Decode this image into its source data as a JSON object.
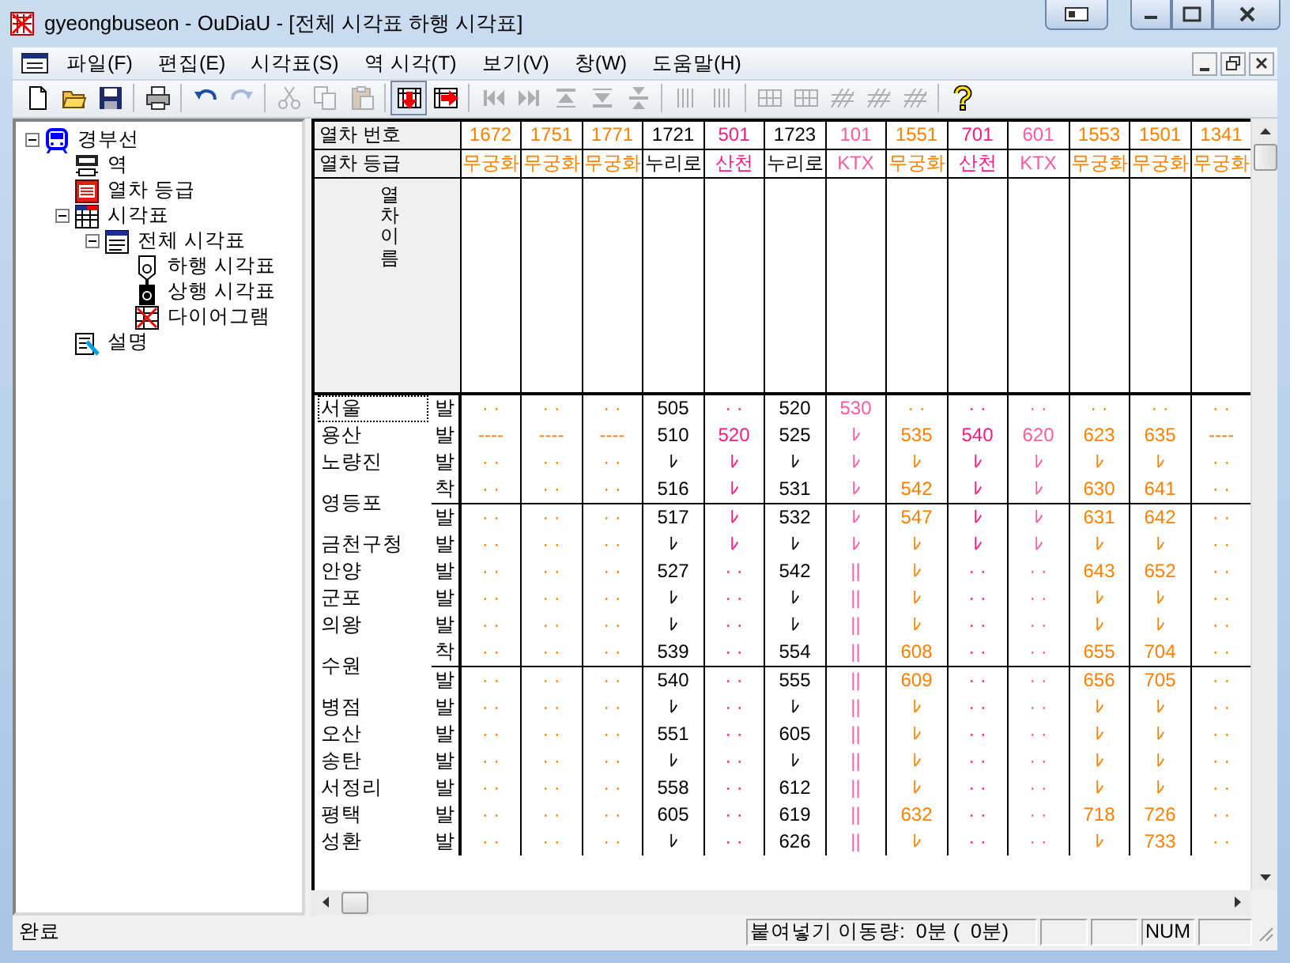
{
  "window": {
    "title": "gyeongbuseon - OuDiaU - [전체 시각표 하행 시각표]"
  },
  "menu": [
    "파일(F)",
    "편집(E)",
    "시각표(S)",
    "역 시각(T)",
    "보기(V)",
    "창(W)",
    "도움말(H)"
  ],
  "toolbar": [
    {
      "kind": "new",
      "disabled": false,
      "pressed": false
    },
    {
      "kind": "open",
      "disabled": false,
      "pressed": false
    },
    {
      "kind": "save",
      "disabled": false,
      "pressed": false
    },
    {
      "kind": "sep"
    },
    {
      "kind": "print",
      "disabled": false,
      "pressed": false
    },
    {
      "kind": "sep"
    },
    {
      "kind": "undo",
      "disabled": false,
      "pressed": false
    },
    {
      "kind": "redo",
      "disabled": true,
      "pressed": false
    },
    {
      "kind": "sep"
    },
    {
      "kind": "cut",
      "disabled": true,
      "pressed": false
    },
    {
      "kind": "copy",
      "disabled": true,
      "pressed": false
    },
    {
      "kind": "paste",
      "disabled": true,
      "pressed": false
    },
    {
      "kind": "sep"
    },
    {
      "kind": "down",
      "disabled": false,
      "pressed": true
    },
    {
      "kind": "right",
      "disabled": false,
      "pressed": false
    },
    {
      "kind": "sep"
    },
    {
      "kind": "first",
      "disabled": true,
      "pressed": false
    },
    {
      "kind": "last",
      "disabled": true,
      "pressed": false
    },
    {
      "kind": "top",
      "disabled": true,
      "pressed": false
    },
    {
      "kind": "bottom",
      "disabled": true,
      "pressed": false
    },
    {
      "kind": "middle",
      "disabled": true,
      "pressed": false
    },
    {
      "kind": "sep"
    },
    {
      "kind": "bars",
      "disabled": true,
      "pressed": false
    },
    {
      "kind": "bars",
      "disabled": true,
      "pressed": false
    },
    {
      "kind": "sep"
    },
    {
      "kind": "block",
      "disabled": true,
      "pressed": false
    },
    {
      "kind": "block",
      "disabled": true,
      "pressed": false
    },
    {
      "kind": "diagonal",
      "disabled": true,
      "pressed": false
    },
    {
      "kind": "diagonal",
      "disabled": true,
      "pressed": false
    },
    {
      "kind": "diagonal",
      "disabled": true,
      "pressed": false
    },
    {
      "kind": "sep"
    },
    {
      "kind": "help",
      "disabled": false,
      "pressed": false
    }
  ],
  "tree": [
    {
      "label": "경부선",
      "kind": "route",
      "expanded": true,
      "children": [
        {
          "label": "역",
          "kind": "station"
        },
        {
          "label": "열차 등급",
          "kind": "grade"
        },
        {
          "label": "시각표",
          "kind": "timetables",
          "expanded": true,
          "children": [
            {
              "label": "전체 시각표",
              "kind": "timetable",
              "expanded": true,
              "children": [
                {
                  "label": "하행 시각표",
                  "kind": "down"
                },
                {
                  "label": "상행 시각표",
                  "kind": "up"
                },
                {
                  "label": "다이어그램",
                  "kind": "diagram"
                }
              ]
            }
          ]
        },
        {
          "label": "설명",
          "kind": "note"
        }
      ]
    }
  ],
  "grid": {
    "number_label": "열차 번호",
    "grade_label": "열차 등급",
    "name_label": "열차 이름",
    "trains": [
      {
        "number": "1672",
        "grade": "무궁화",
        "color": "#ff8000"
      },
      {
        "number": "1751",
        "grade": "무궁화",
        "color": "#ff8000"
      },
      {
        "number": "1771",
        "grade": "무궁화",
        "color": "#ff8000"
      },
      {
        "number": "1721",
        "grade": "누리로",
        "color": "#000000"
      },
      {
        "number": "501",
        "grade": "산천",
        "color": "#ff1a80"
      },
      {
        "number": "1723",
        "grade": "누리로",
        "color": "#000000"
      },
      {
        "number": "101",
        "grade": "KTX",
        "color": "#ff5aa0"
      },
      {
        "number": "1551",
        "grade": "무궁화",
        "color": "#ff8000"
      },
      {
        "number": "701",
        "grade": "산천",
        "color": "#ff1a80"
      },
      {
        "number": "601",
        "grade": "KTX",
        "color": "#ff5aa0"
      },
      {
        "number": "1553",
        "grade": "무궁화",
        "color": "#ff8000"
      },
      {
        "number": "1501",
        "grade": "무궁화",
        "color": "#ff8000"
      },
      {
        "number": "1341",
        "grade": "무궁화",
        "color": "#ff8000"
      }
    ],
    "stations": [
      {
        "name": "서울",
        "selected": true,
        "stops": [
          {
            "kind": "발",
            "times": [
              "· ·",
              "· ·",
              "· ·",
              "505",
              "· ·",
              "520",
              "530",
              "· ·",
              "· ·",
              "· ·",
              "· ·",
              "· ·",
              "· ·"
            ]
          }
        ]
      },
      {
        "name": "용산",
        "selected": false,
        "stops": [
          {
            "kind": "발",
            "times": [
              "----",
              "----",
              "----",
              "510",
              "520",
              "525",
              "ﾚ",
              "535",
              "540",
              "620",
              "623",
              "635",
              "----"
            ]
          }
        ]
      },
      {
        "name": "노량진",
        "selected": false,
        "stops": [
          {
            "kind": "발",
            "times": [
              "· ·",
              "· ·",
              "· ·",
              "ﾚ",
              "ﾚ",
              "ﾚ",
              "ﾚ",
              "ﾚ",
              "ﾚ",
              "ﾚ",
              "ﾚ",
              "ﾚ",
              "· ·"
            ]
          }
        ]
      },
      {
        "name": "영등포",
        "selected": false,
        "stops": [
          {
            "kind": "착",
            "times": [
              "· ·",
              "· ·",
              "· ·",
              "516",
              "ﾚ",
              "531",
              "ﾚ",
              "542",
              "ﾚ",
              "ﾚ",
              "630",
              "641",
              "· ·"
            ]
          },
          {
            "kind": "발",
            "times": [
              "· ·",
              "· ·",
              "· ·",
              "517",
              "ﾚ",
              "532",
              "ﾚ",
              "547",
              "ﾚ",
              "ﾚ",
              "631",
              "642",
              "· ·"
            ]
          }
        ]
      },
      {
        "name": "금천구청",
        "selected": false,
        "stops": [
          {
            "kind": "발",
            "times": [
              "· ·",
              "· ·",
              "· ·",
              "ﾚ",
              "ﾚ",
              "ﾚ",
              "ﾚ",
              "ﾚ",
              "ﾚ",
              "ﾚ",
              "ﾚ",
              "ﾚ",
              "· ·"
            ]
          }
        ]
      },
      {
        "name": "안양",
        "selected": false,
        "stops": [
          {
            "kind": "발",
            "times": [
              "· ·",
              "· ·",
              "· ·",
              "527",
              "· ·",
              "542",
              "||",
              "ﾚ",
              "· ·",
              "· ·",
              "643",
              "652",
              "· ·"
            ]
          }
        ]
      },
      {
        "name": "군포",
        "selected": false,
        "stops": [
          {
            "kind": "발",
            "times": [
              "· ·",
              "· ·",
              "· ·",
              "ﾚ",
              "· ·",
              "ﾚ",
              "||",
              "ﾚ",
              "· ·",
              "· ·",
              "ﾚ",
              "ﾚ",
              "· ·"
            ]
          }
        ]
      },
      {
        "name": "의왕",
        "selected": false,
        "stops": [
          {
            "kind": "발",
            "times": [
              "· ·",
              "· ·",
              "· ·",
              "ﾚ",
              "· ·",
              "ﾚ",
              "||",
              "ﾚ",
              "· ·",
              "· ·",
              "ﾚ",
              "ﾚ",
              "· ·"
            ]
          }
        ]
      },
      {
        "name": "수원",
        "selected": false,
        "stops": [
          {
            "kind": "착",
            "times": [
              "· ·",
              "· ·",
              "· ·",
              "539",
              "· ·",
              "554",
              "||",
              "608",
              "· ·",
              "· ·",
              "655",
              "704",
              "· ·"
            ]
          },
          {
            "kind": "발",
            "times": [
              "· ·",
              "· ·",
              "· ·",
              "540",
              "· ·",
              "555",
              "||",
              "609",
              "· ·",
              "· ·",
              "656",
              "705",
              "· ·"
            ]
          }
        ]
      },
      {
        "name": "병점",
        "selected": false,
        "stops": [
          {
            "kind": "발",
            "times": [
              "· ·",
              "· ·",
              "· ·",
              "ﾚ",
              "· ·",
              "ﾚ",
              "||",
              "ﾚ",
              "· ·",
              "· ·",
              "ﾚ",
              "ﾚ",
              "· ·"
            ]
          }
        ]
      },
      {
        "name": "오산",
        "selected": false,
        "stops": [
          {
            "kind": "발",
            "times": [
              "· ·",
              "· ·",
              "· ·",
              "551",
              "· ·",
              "605",
              "||",
              "ﾚ",
              "· ·",
              "· ·",
              "ﾚ",
              "ﾚ",
              "· ·"
            ]
          }
        ]
      },
      {
        "name": "송탄",
        "selected": false,
        "stops": [
          {
            "kind": "발",
            "times": [
              "· ·",
              "· ·",
              "· ·",
              "ﾚ",
              "· ·",
              "ﾚ",
              "||",
              "ﾚ",
              "· ·",
              "· ·",
              "ﾚ",
              "ﾚ",
              "· ·"
            ]
          }
        ]
      },
      {
        "name": "서정리",
        "selected": false,
        "stops": [
          {
            "kind": "발",
            "times": [
              "· ·",
              "· ·",
              "· ·",
              "558",
              "· ·",
              "612",
              "||",
              "ﾚ",
              "· ·",
              "· ·",
              "ﾚ",
              "ﾚ",
              "· ·"
            ]
          }
        ]
      },
      {
        "name": "평택",
        "selected": false,
        "stops": [
          {
            "kind": "발",
            "times": [
              "· ·",
              "· ·",
              "· ·",
              "605",
              "· ·",
              "619",
              "||",
              "632",
              "· ·",
              "· ·",
              "718",
              "726",
              "· ·"
            ]
          }
        ]
      },
      {
        "name": "성환",
        "selected": false,
        "stops": [
          {
            "kind": "발",
            "times": [
              "· ·",
              "· ·",
              "· ·",
              "ﾚ",
              "· ·",
              "626",
              "||",
              "ﾚ",
              "· ·",
              "· ·",
              "ﾚ",
              "733",
              "· ·"
            ]
          }
        ]
      }
    ]
  },
  "status_bar": {
    "message": "완료",
    "paste_amount": "붙여넣기 이동량:  0분 (  0분)",
    "num_lock": "NUM"
  }
}
